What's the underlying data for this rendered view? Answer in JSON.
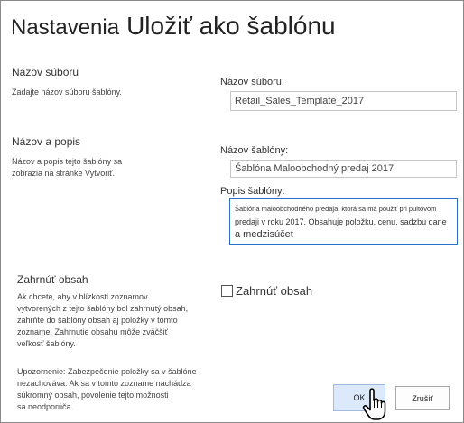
{
  "header": {
    "breadcrumb": "Nastavenia",
    "title": "Uložiť ako šablónu"
  },
  "sections": {
    "file_name": {
      "title": "Názov súboru",
      "description": "Zadajte názov súboru šablóny."
    },
    "name_desc": {
      "title": "Názov a popis",
      "description": [
        "Názov a popis tejto šablóny sa",
        "zobrazia na stránke Vytvoriť."
      ]
    },
    "include_content": {
      "title": "Zahrnúť obsah",
      "description": [
        "Ak chcete, aby v blízkosti zoznamov",
        "vytvorených z tejto šablóny bol zahrnutý obsah,",
        "zahrňte do šablóny obsah aj položky v tomto",
        "zozname. Zahrnutie obsahu môže zväčšiť",
        "veľkosť šablóny."
      ],
      "warning": [
        "Upozornenie: Zabezpečenie položky sa v šablóne",
        "nezachováva. Ak sa v tomto zozname nachádza",
        "súkromný obsah, povolenie tejto možnosti",
        "sa neodporúča."
      ]
    }
  },
  "form": {
    "file_name_label": "Názov súboru:",
    "file_name_value": "Retail_Sales_Template_2017",
    "template_name_label": "Názov šablóny:",
    "template_name_value": "Šablóna Maloobchodný predaj 2017",
    "description_label": "Popis šablóny:",
    "description_lines": [
      "Šablóna maloobchodného predaja, ktorá sa má použiť pri pultovom",
      "predaji v roku 2017. Obsahuje položku, cenu, sadzbu dane",
      "a medzisúčet"
    ],
    "include_content_label": "Zahrnúť obsah",
    "include_content_checked": false
  },
  "buttons": {
    "ok": "OK",
    "cancel": "Zrušiť"
  },
  "icons": {
    "cursor": "hand-pointer-icon"
  }
}
